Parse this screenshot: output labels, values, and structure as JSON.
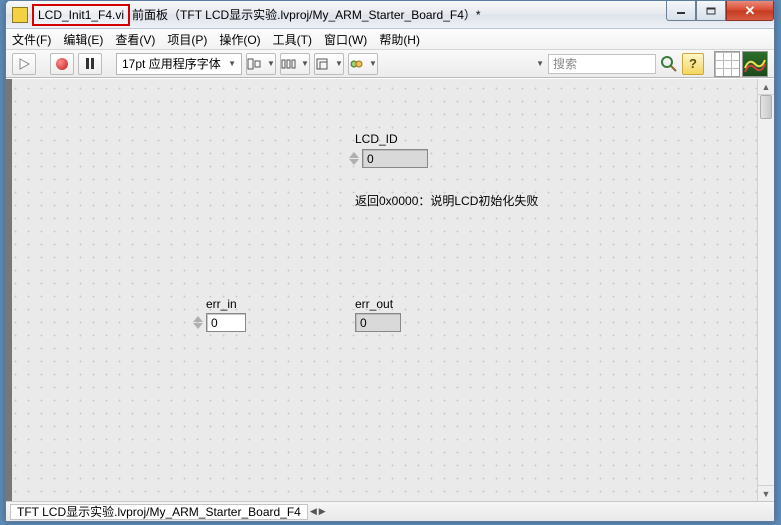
{
  "title": {
    "highlighted": "LCD_Init1_F4.vi",
    "rest": "前面板（TFT LCD显示实验.lvproj/My_ARM_Starter_Board_F4）*"
  },
  "menus": {
    "file": "文件(F)",
    "edit": "编辑(E)",
    "view": "查看(V)",
    "project": "项目(P)",
    "operate": "操作(O)",
    "tools": "工具(T)",
    "window": "窗口(W)",
    "help": "帮助(H)"
  },
  "toolbar": {
    "font": "17pt 应用程序字体",
    "search_placeholder": "搜索",
    "help_label": "?"
  },
  "panel": {
    "lcd_id_label": "LCD_ID",
    "lcd_id_value": "0",
    "note": "返回0x0000：说明LCD初始化失败",
    "err_in_label": "err_in",
    "err_in_value": "0",
    "err_out_label": "err_out",
    "err_out_value": "0"
  },
  "status": {
    "path": "TFT LCD显示实验.lvproj/My_ARM_Starter_Board_F4"
  }
}
